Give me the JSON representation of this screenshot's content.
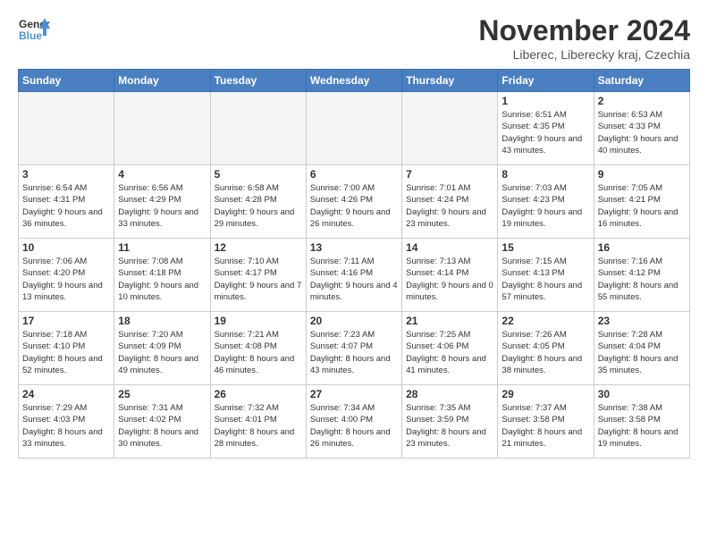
{
  "header": {
    "logo_line1": "General",
    "logo_line2": "Blue",
    "month_title": "November 2024",
    "subtitle": "Liberec, Liberecky kraj, Czechia"
  },
  "weekdays": [
    "Sunday",
    "Monday",
    "Tuesday",
    "Wednesday",
    "Thursday",
    "Friday",
    "Saturday"
  ],
  "weeks": [
    [
      {
        "day": "",
        "empty": true
      },
      {
        "day": "",
        "empty": true
      },
      {
        "day": "",
        "empty": true
      },
      {
        "day": "",
        "empty": true
      },
      {
        "day": "",
        "empty": true
      },
      {
        "day": "1",
        "sunrise": "Sunrise: 6:51 AM",
        "sunset": "Sunset: 4:35 PM",
        "daylight": "Daylight: 9 hours and 43 minutes."
      },
      {
        "day": "2",
        "sunrise": "Sunrise: 6:53 AM",
        "sunset": "Sunset: 4:33 PM",
        "daylight": "Daylight: 9 hours and 40 minutes."
      }
    ],
    [
      {
        "day": "3",
        "sunrise": "Sunrise: 6:54 AM",
        "sunset": "Sunset: 4:31 PM",
        "daylight": "Daylight: 9 hours and 36 minutes."
      },
      {
        "day": "4",
        "sunrise": "Sunrise: 6:56 AM",
        "sunset": "Sunset: 4:29 PM",
        "daylight": "Daylight: 9 hours and 33 minutes."
      },
      {
        "day": "5",
        "sunrise": "Sunrise: 6:58 AM",
        "sunset": "Sunset: 4:28 PM",
        "daylight": "Daylight: 9 hours and 29 minutes."
      },
      {
        "day": "6",
        "sunrise": "Sunrise: 7:00 AM",
        "sunset": "Sunset: 4:26 PM",
        "daylight": "Daylight: 9 hours and 26 minutes."
      },
      {
        "day": "7",
        "sunrise": "Sunrise: 7:01 AM",
        "sunset": "Sunset: 4:24 PM",
        "daylight": "Daylight: 9 hours and 23 minutes."
      },
      {
        "day": "8",
        "sunrise": "Sunrise: 7:03 AM",
        "sunset": "Sunset: 4:23 PM",
        "daylight": "Daylight: 9 hours and 19 minutes."
      },
      {
        "day": "9",
        "sunrise": "Sunrise: 7:05 AM",
        "sunset": "Sunset: 4:21 PM",
        "daylight": "Daylight: 9 hours and 16 minutes."
      }
    ],
    [
      {
        "day": "10",
        "sunrise": "Sunrise: 7:06 AM",
        "sunset": "Sunset: 4:20 PM",
        "daylight": "Daylight: 9 hours and 13 minutes."
      },
      {
        "day": "11",
        "sunrise": "Sunrise: 7:08 AM",
        "sunset": "Sunset: 4:18 PM",
        "daylight": "Daylight: 9 hours and 10 minutes."
      },
      {
        "day": "12",
        "sunrise": "Sunrise: 7:10 AM",
        "sunset": "Sunset: 4:17 PM",
        "daylight": "Daylight: 9 hours and 7 minutes."
      },
      {
        "day": "13",
        "sunrise": "Sunrise: 7:11 AM",
        "sunset": "Sunset: 4:16 PM",
        "daylight": "Daylight: 9 hours and 4 minutes."
      },
      {
        "day": "14",
        "sunrise": "Sunrise: 7:13 AM",
        "sunset": "Sunset: 4:14 PM",
        "daylight": "Daylight: 9 hours and 0 minutes."
      },
      {
        "day": "15",
        "sunrise": "Sunrise: 7:15 AM",
        "sunset": "Sunset: 4:13 PM",
        "daylight": "Daylight: 8 hours and 57 minutes."
      },
      {
        "day": "16",
        "sunrise": "Sunrise: 7:16 AM",
        "sunset": "Sunset: 4:12 PM",
        "daylight": "Daylight: 8 hours and 55 minutes."
      }
    ],
    [
      {
        "day": "17",
        "sunrise": "Sunrise: 7:18 AM",
        "sunset": "Sunset: 4:10 PM",
        "daylight": "Daylight: 8 hours and 52 minutes."
      },
      {
        "day": "18",
        "sunrise": "Sunrise: 7:20 AM",
        "sunset": "Sunset: 4:09 PM",
        "daylight": "Daylight: 8 hours and 49 minutes."
      },
      {
        "day": "19",
        "sunrise": "Sunrise: 7:21 AM",
        "sunset": "Sunset: 4:08 PM",
        "daylight": "Daylight: 8 hours and 46 minutes."
      },
      {
        "day": "20",
        "sunrise": "Sunrise: 7:23 AM",
        "sunset": "Sunset: 4:07 PM",
        "daylight": "Daylight: 8 hours and 43 minutes."
      },
      {
        "day": "21",
        "sunrise": "Sunrise: 7:25 AM",
        "sunset": "Sunset: 4:06 PM",
        "daylight": "Daylight: 8 hours and 41 minutes."
      },
      {
        "day": "22",
        "sunrise": "Sunrise: 7:26 AM",
        "sunset": "Sunset: 4:05 PM",
        "daylight": "Daylight: 8 hours and 38 minutes."
      },
      {
        "day": "23",
        "sunrise": "Sunrise: 7:28 AM",
        "sunset": "Sunset: 4:04 PM",
        "daylight": "Daylight: 8 hours and 35 minutes."
      }
    ],
    [
      {
        "day": "24",
        "sunrise": "Sunrise: 7:29 AM",
        "sunset": "Sunset: 4:03 PM",
        "daylight": "Daylight: 8 hours and 33 minutes."
      },
      {
        "day": "25",
        "sunrise": "Sunrise: 7:31 AM",
        "sunset": "Sunset: 4:02 PM",
        "daylight": "Daylight: 8 hours and 30 minutes."
      },
      {
        "day": "26",
        "sunrise": "Sunrise: 7:32 AM",
        "sunset": "Sunset: 4:01 PM",
        "daylight": "Daylight: 8 hours and 28 minutes."
      },
      {
        "day": "27",
        "sunrise": "Sunrise: 7:34 AM",
        "sunset": "Sunset: 4:00 PM",
        "daylight": "Daylight: 8 hours and 26 minutes."
      },
      {
        "day": "28",
        "sunrise": "Sunrise: 7:35 AM",
        "sunset": "Sunset: 3:59 PM",
        "daylight": "Daylight: 8 hours and 23 minutes."
      },
      {
        "day": "29",
        "sunrise": "Sunrise: 7:37 AM",
        "sunset": "Sunset: 3:58 PM",
        "daylight": "Daylight: 8 hours and 21 minutes."
      },
      {
        "day": "30",
        "sunrise": "Sunrise: 7:38 AM",
        "sunset": "Sunset: 3:58 PM",
        "daylight": "Daylight: 8 hours and 19 minutes."
      }
    ]
  ]
}
